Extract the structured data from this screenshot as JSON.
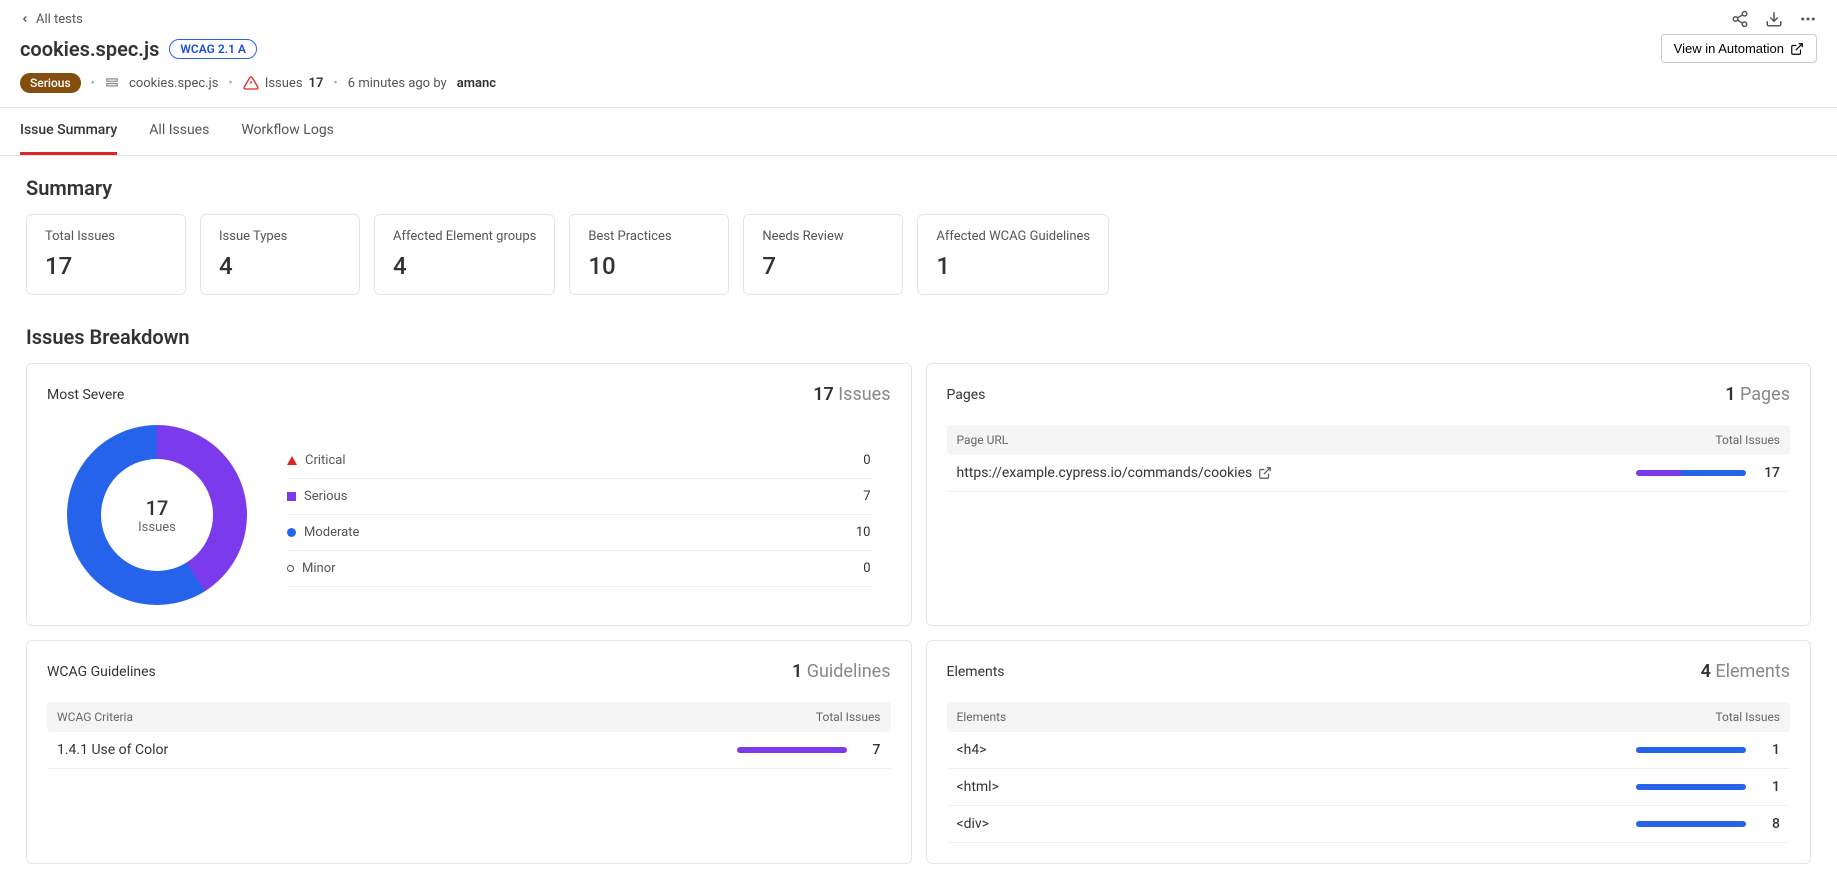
{
  "back": {
    "label": "All tests"
  },
  "header": {
    "title": "cookies.spec.js",
    "wcag_badge": "WCAG 2.1 A",
    "severity": "Serious",
    "spec_file": "cookies.spec.js",
    "issues_label": "Issues",
    "issues_count": "17",
    "timestamp": "6 minutes ago by",
    "author": "amanc",
    "view_automation": "View in Automation"
  },
  "tabs": {
    "summary": "Issue Summary",
    "all": "All Issues",
    "logs": "Workflow Logs"
  },
  "summary": {
    "title": "Summary",
    "cards": {
      "total_issues": {
        "label": "Total Issues",
        "value": "17"
      },
      "issue_types": {
        "label": "Issue Types",
        "value": "4"
      },
      "element_groups": {
        "label": "Affected Element groups",
        "value": "4"
      },
      "best_practices": {
        "label": "Best Practices",
        "value": "10"
      },
      "needs_review": {
        "label": "Needs Review",
        "value": "7"
      },
      "wcag_guidelines": {
        "label": "Affected WCAG Guidelines",
        "value": "1"
      }
    }
  },
  "breakdown": {
    "title": "Issues Breakdown",
    "most_severe": {
      "title": "Most Severe",
      "count": "17",
      "unit": "Issues",
      "center_num": "17",
      "center_text": "Issues",
      "legend": {
        "critical": {
          "label": "Critical",
          "value": "0"
        },
        "serious": {
          "label": "Serious",
          "value": "7"
        },
        "moderate": {
          "label": "Moderate",
          "value": "10"
        },
        "minor": {
          "label": "Minor",
          "value": "0"
        }
      }
    },
    "pages": {
      "title": "Pages",
      "count": "1",
      "unit": "Pages",
      "col_url": "Page URL",
      "col_issues": "Total Issues",
      "rows": [
        {
          "url": "https://example.cypress.io/commands/cookies",
          "issues": "17"
        }
      ]
    },
    "wcag": {
      "title": "WCAG Guidelines",
      "count": "1",
      "unit": "Guidelines",
      "col_criteria": "WCAG Criteria",
      "col_issues": "Total Issues",
      "rows": [
        {
          "criteria": "1.4.1 Use of Color",
          "issues": "7"
        }
      ]
    },
    "elements": {
      "title": "Elements",
      "count": "4",
      "unit": "Elements",
      "col_elements": "Elements",
      "col_issues": "Total Issues",
      "rows": [
        {
          "el": "<h4>",
          "issues": "1"
        },
        {
          "el": "<html>",
          "issues": "1"
        },
        {
          "el": "<div>",
          "issues": "8"
        }
      ]
    }
  },
  "chart_data": {
    "type": "pie",
    "title": "Most Severe",
    "categories": [
      "Critical",
      "Serious",
      "Moderate",
      "Minor"
    ],
    "values": [
      0,
      7,
      10,
      0
    ],
    "colors": [
      "#dc2626",
      "#7c3aed",
      "#2563eb",
      "#ffffff"
    ],
    "total": 17
  }
}
